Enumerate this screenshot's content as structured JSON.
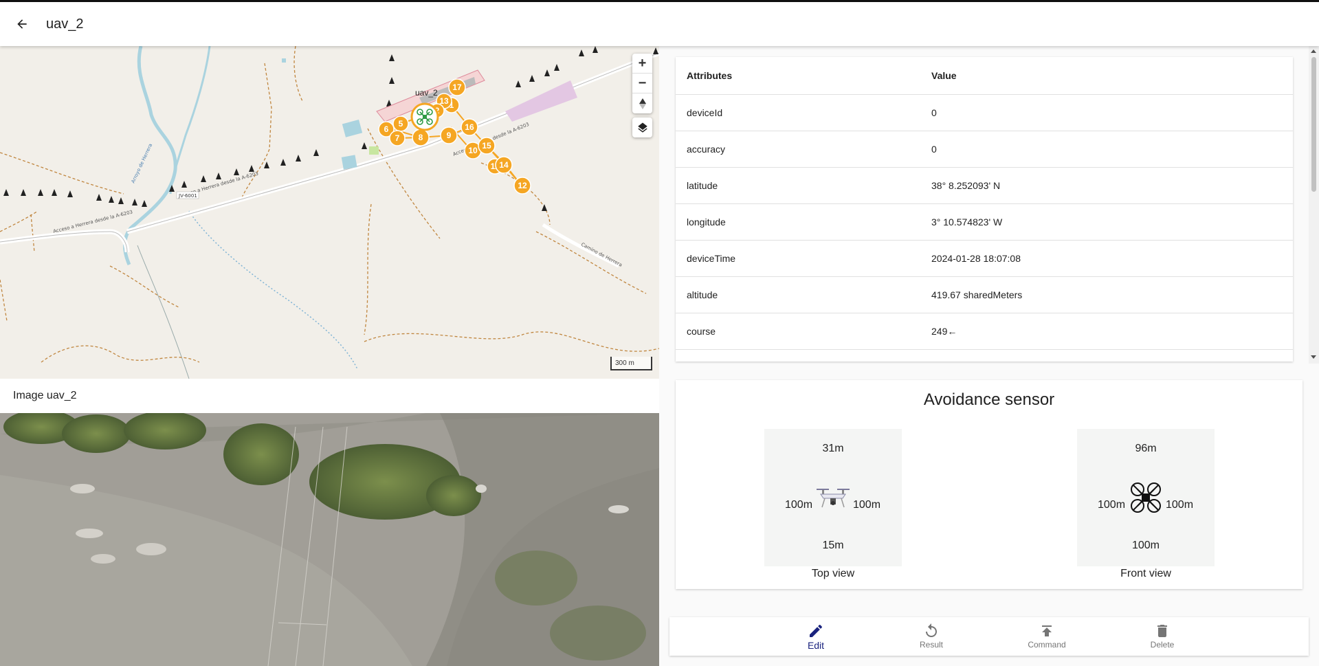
{
  "appbar": {
    "title": "uav_2"
  },
  "map": {
    "device_label": "uav_2",
    "scale_label": "300 m",
    "waypoints": [
      "1",
      "2",
      "5",
      "6",
      "7",
      "8",
      "9",
      "10",
      "11",
      "12",
      "13",
      "14",
      "15",
      "16",
      "17"
    ],
    "road_labels": [
      "JV-6001",
      "Acceso a Herrera desde la A-6203",
      "Camino de Herrera",
      "Arroyo de Herrera"
    ]
  },
  "image_card": {
    "title": "Image uav_2"
  },
  "attributes": {
    "headers": {
      "attribute": "Attributes",
      "value": "Value"
    },
    "rows": [
      {
        "name": "deviceId",
        "value": "0"
      },
      {
        "name": "accuracy",
        "value": "0"
      },
      {
        "name": "latitude",
        "value": "38° 8.252093' N"
      },
      {
        "name": "longitude",
        "value": "3° 10.574823' W"
      },
      {
        "name": "deviceTime",
        "value": "2024-01-28 18:07:08"
      },
      {
        "name": "altitude",
        "value": "419.67 sharedMeters"
      },
      {
        "name": "course",
        "value": "249←"
      }
    ]
  },
  "sensor": {
    "title": "Avoidance sensor",
    "top_view": {
      "caption": "Top view",
      "top": "31m",
      "left": "100m",
      "right": "100m",
      "bottom": "15m"
    },
    "front_view": {
      "caption": "Front view",
      "top": "96m",
      "left": "100m",
      "right": "100m",
      "bottom": "100m"
    }
  },
  "bottom_nav": {
    "edit": "Edit",
    "result": "Result",
    "command": "Command",
    "delete": "Delete",
    "active_color": "#1a237e"
  }
}
